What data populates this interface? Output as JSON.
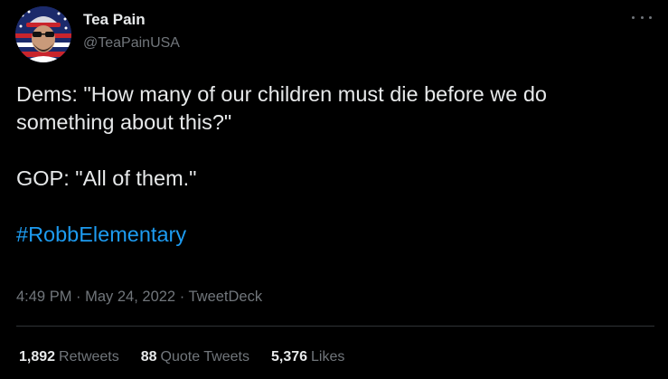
{
  "author": {
    "display_name": "Tea Pain",
    "handle": "@TeaPainUSA"
  },
  "tweet": {
    "line1": "Dems: \"How many of our children must die before we do something about this?\"",
    "line2": "GOP: \"All of them.\"",
    "hashtag": "#RobbElementary"
  },
  "meta": {
    "time": "4:49 PM",
    "sep1": " · ",
    "date": "May 24, 2022",
    "sep2": " · ",
    "source": "TweetDeck"
  },
  "stats": {
    "retweets": {
      "count": "1,892",
      "label": "Retweets"
    },
    "quotes": {
      "count": "88",
      "label": "Quote Tweets"
    },
    "likes": {
      "count": "5,376",
      "label": "Likes"
    }
  },
  "colors": {
    "background": "#000000",
    "text": "#e7e9ea",
    "secondary": "#71767b",
    "link": "#1d9bf0",
    "divider": "#2f3336"
  },
  "icons": {
    "more": "more-icon",
    "avatar": "avatar"
  }
}
